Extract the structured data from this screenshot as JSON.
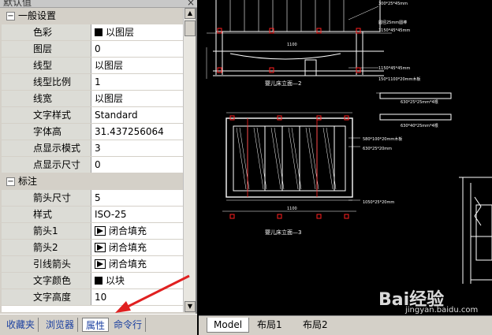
{
  "panel": {
    "title": "默认值",
    "close": "×"
  },
  "groups": [
    {
      "name": "一般设置",
      "rows": [
        {
          "key": "色彩",
          "value": "以图层",
          "icon": "swatch"
        },
        {
          "key": "图层",
          "value": "0"
        },
        {
          "key": "线型",
          "value": "以图层"
        },
        {
          "key": "线型比例",
          "value": "1"
        },
        {
          "key": "线宽",
          "value": "以图层"
        },
        {
          "key": "文字样式",
          "value": "Standard"
        },
        {
          "key": "字体高",
          "value": "31.437256064"
        },
        {
          "key": "点显示模式",
          "value": "3"
        },
        {
          "key": "点显示尺寸",
          "value": "0"
        }
      ]
    },
    {
      "name": "标注",
      "rows": [
        {
          "key": "箭头尺寸",
          "value": "5"
        },
        {
          "key": "样式",
          "value": "ISO-25"
        },
        {
          "key": "箭头1",
          "value": "闭合填充",
          "icon": "arrow"
        },
        {
          "key": "箭头2",
          "value": "闭合填充",
          "icon": "arrow"
        },
        {
          "key": "引线箭头",
          "value": "闭合填充",
          "icon": "arrow"
        },
        {
          "key": "文字颜色",
          "value": "以块",
          "icon": "swatch"
        },
        {
          "key": "文字高度",
          "value": "10"
        }
      ]
    }
  ],
  "left_tabs": [
    "收藏夹",
    "浏览器",
    "属性",
    "命令行"
  ],
  "active_left_tab": "属性",
  "layout_tabs": [
    "Model",
    "布局1",
    "布局2"
  ],
  "active_layout_tab": "Model",
  "drawing": {
    "labels": {
      "view2": "婴儿床立面—2",
      "view3": "婴儿床立面—3",
      "dim_1100": "1100",
      "dim_1100b": "1100",
      "n1": "300*25*45mm",
      "n2": "圆径25mm圆棒",
      "n3": "1150*45*45mm",
      "n4": "1150*45*45mm",
      "n5": "150*1100*20mm木板",
      "n6": "630*25*25mm*4根",
      "n7": "630*40*25mm*4根",
      "n8": "580*100*20mm木板",
      "n9": "630*25*20mm",
      "n10": "1050*25*20mm"
    }
  },
  "watermark": {
    "brand": "Bai经验",
    "url": "jingyan.baidu.com"
  },
  "colors": {
    "accent": "#e02020",
    "drawing_line": "#ffffff",
    "drawing_red": "#ff2020",
    "tab_text": "#1a3fa0"
  }
}
